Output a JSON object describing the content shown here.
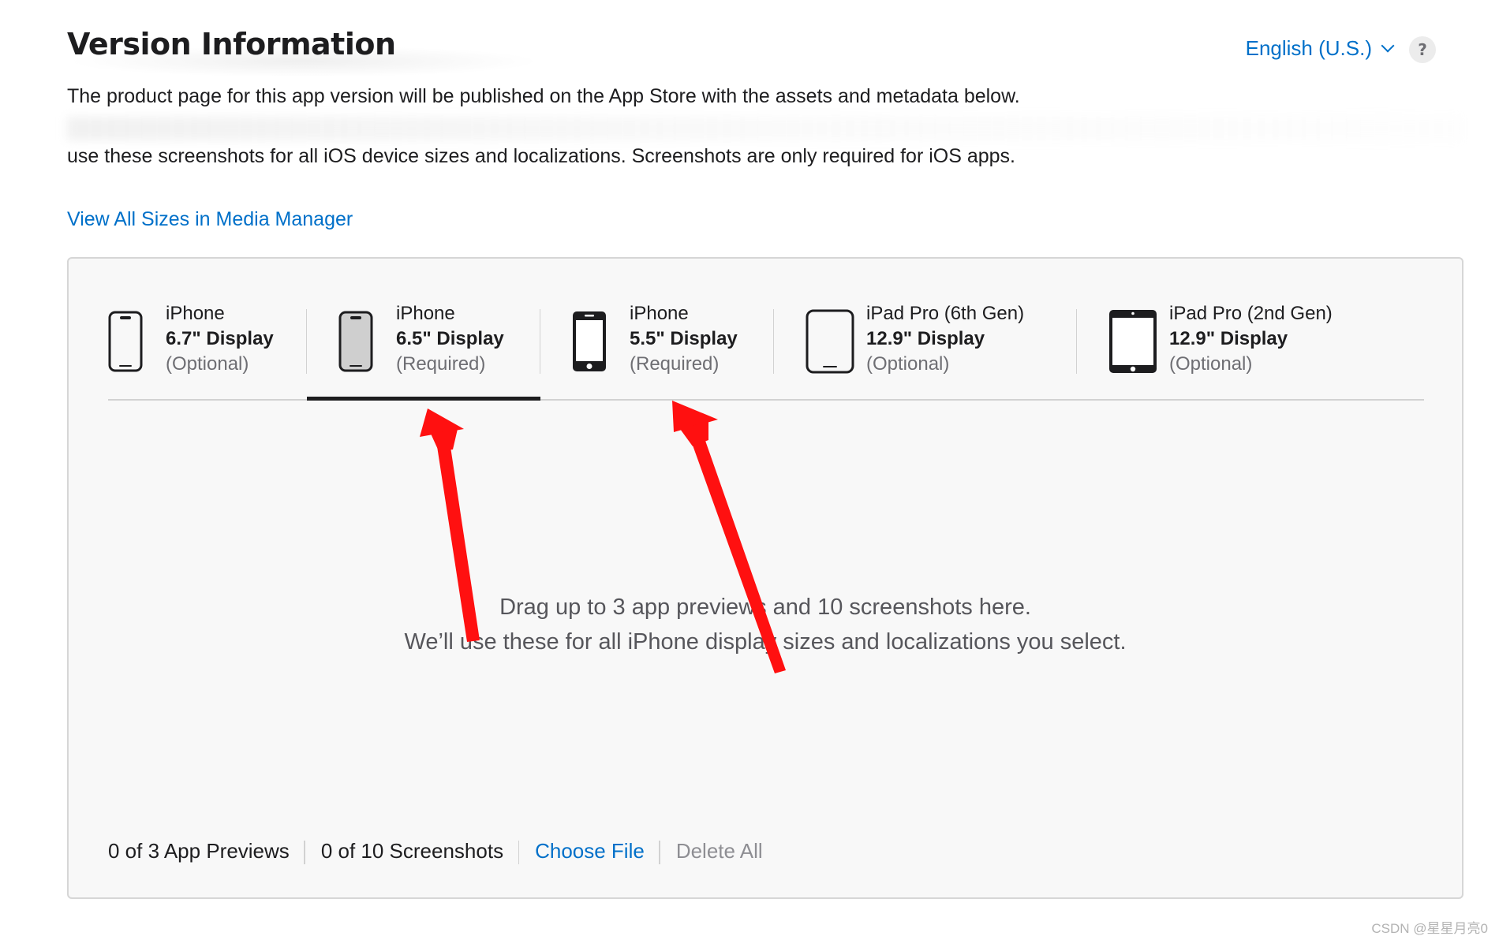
{
  "header": {
    "title": "Version Information",
    "language": "English (U.S.)",
    "help_label": "?"
  },
  "description": {
    "line1": "The product page for this app version will be published on the App Store with the assets and metadata below.",
    "line2": "use these screenshots for all iOS device sizes and localizations. Screenshots are only required for iOS apps."
  },
  "media_manager_link": "View All Sizes in Media Manager",
  "device_tabs": [
    {
      "line1": "iPhone",
      "line2": "6.7\" Display",
      "line3": "(Optional)",
      "icon": "iphone-notch-outline-icon",
      "active": false
    },
    {
      "line1": "iPhone",
      "line2": "6.5\" Display",
      "line3": "(Required)",
      "icon": "iphone-notch-filled-icon",
      "active": true
    },
    {
      "line1": "iPhone",
      "line2": "5.5\" Display",
      "line3": "(Required)",
      "icon": "iphone-home-button-icon",
      "active": false
    },
    {
      "line1": "iPad Pro (6th Gen)",
      "line2": "12.9\" Display",
      "line3": "(Optional)",
      "icon": "ipad-outline-icon",
      "active": false
    },
    {
      "line1": "iPad Pro (2nd Gen)",
      "line2": "12.9\" Display",
      "line3": "(Optional)",
      "icon": "ipad-home-button-icon",
      "active": false
    }
  ],
  "drop_zone": {
    "line1": "Drag up to 3 app previews and 10 screenshots here.",
    "line2": "We’ll use these for all iPhone display sizes and localizations you select."
  },
  "footer": {
    "previews_count": "0 of 3 App Previews",
    "screenshots_count": "0 of 10 Screenshots",
    "choose_file": "Choose File",
    "delete_all": "Delete All"
  },
  "colors": {
    "link_blue": "#0070c9",
    "annotation_red": "#ff0000",
    "panel_bg": "#f8f8f8"
  },
  "watermark": "CSDN @星星月亮0"
}
